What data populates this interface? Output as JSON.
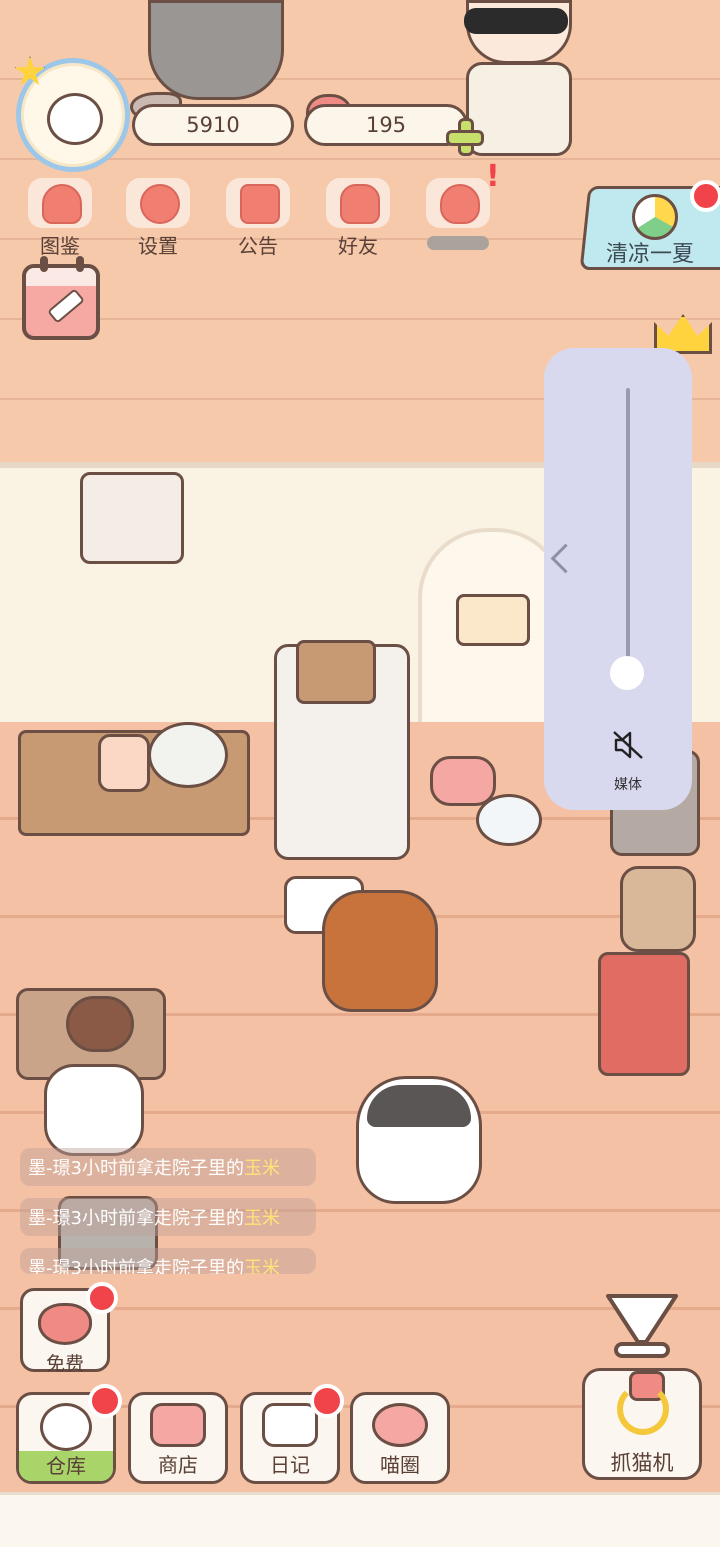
{
  "currency": {
    "fish_coins": "5910",
    "hearts": "195"
  },
  "top_menu": [
    {
      "label": "图鉴",
      "icon": "cat-book-icon"
    },
    {
      "label": "设置",
      "icon": "gear-icon"
    },
    {
      "label": "公告",
      "icon": "gift-icon"
    },
    {
      "label": "好友",
      "icon": "friends-icon"
    },
    {
      "label": "",
      "icon": "heart-break-icon"
    }
  ],
  "event_banner": {
    "label": "清凉一夏"
  },
  "volume_overlay": {
    "media_label": "媒体",
    "level": 0.1
  },
  "chat_feed": [
    {
      "user": "墨-璟",
      "text": "3小时前拿走院子里的",
      "item": "玉米"
    },
    {
      "user": "墨-璟",
      "text": "3小时前拿走院子里的",
      "item": "玉米"
    },
    {
      "user": "墨-璟",
      "text": "3小时前拿走院子里的",
      "item": "玉米"
    }
  ],
  "free_button": {
    "label": "免费"
  },
  "bottom_nav": [
    {
      "label": "仓库",
      "icon": "storage-icon"
    },
    {
      "label": "商店",
      "icon": "shop-icon"
    },
    {
      "label": "日记",
      "icon": "diary-icon"
    },
    {
      "label": "喵圈",
      "icon": "cat-planet-icon"
    }
  ],
  "claw_machine": {
    "label": "抓猫机"
  },
  "colors": {
    "brick": "#f5c1a4",
    "wall": "#faf2e2",
    "outline": "#6b4f44",
    "notify_red": "#f0444a",
    "accent_green": "#a9d46a",
    "overlay": "#d8d8ee"
  }
}
